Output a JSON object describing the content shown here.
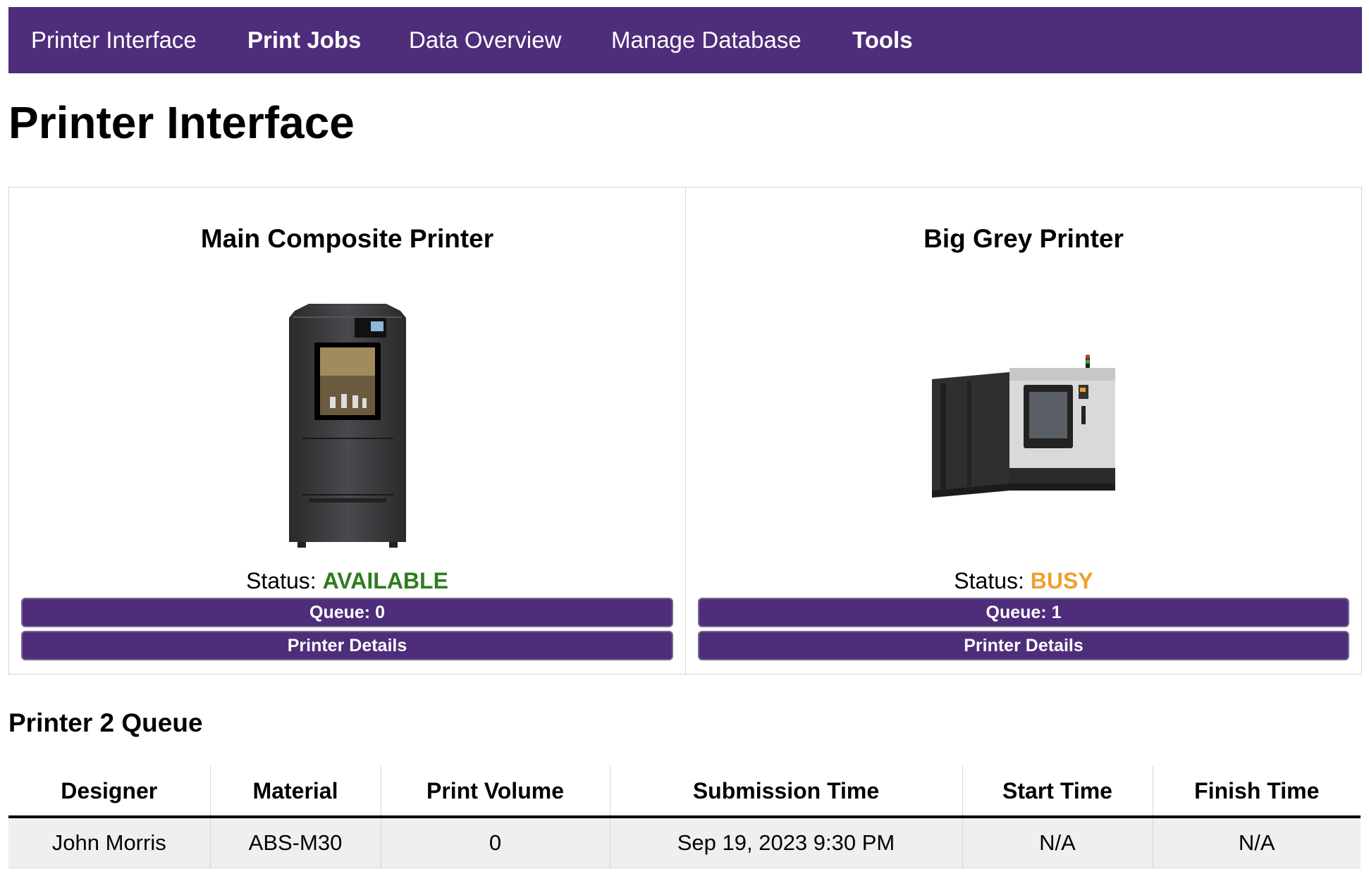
{
  "nav": {
    "items": [
      {
        "label": "Printer Interface"
      },
      {
        "label": "Print Jobs"
      },
      {
        "label": "Data Overview"
      },
      {
        "label": "Manage Database"
      },
      {
        "label": "Tools"
      }
    ]
  },
  "page": {
    "title": "Printer Interface"
  },
  "printers": [
    {
      "name": "Main Composite Printer",
      "status_label": "Status:",
      "status": "AVAILABLE",
      "status_color": "#2e7d1f",
      "queue_label": "Queue: 0",
      "details_label": "Printer Details"
    },
    {
      "name": "Big Grey Printer",
      "status_label": "Status:",
      "status": "BUSY",
      "status_color": "#f0a030",
      "queue_label": "Queue: 1",
      "details_label": "Printer Details"
    }
  ],
  "queue": {
    "title": "Printer 2 Queue",
    "columns": [
      "Designer",
      "Material",
      "Print Volume",
      "Submission Time",
      "Start Time",
      "Finish Time"
    ],
    "rows": [
      [
        "John Morris",
        "ABS-M30",
        "0",
        "Sep 19, 2023 9:30 PM",
        "N/A",
        "N/A"
      ]
    ]
  },
  "colors": {
    "accent": "#4e2d7a"
  }
}
